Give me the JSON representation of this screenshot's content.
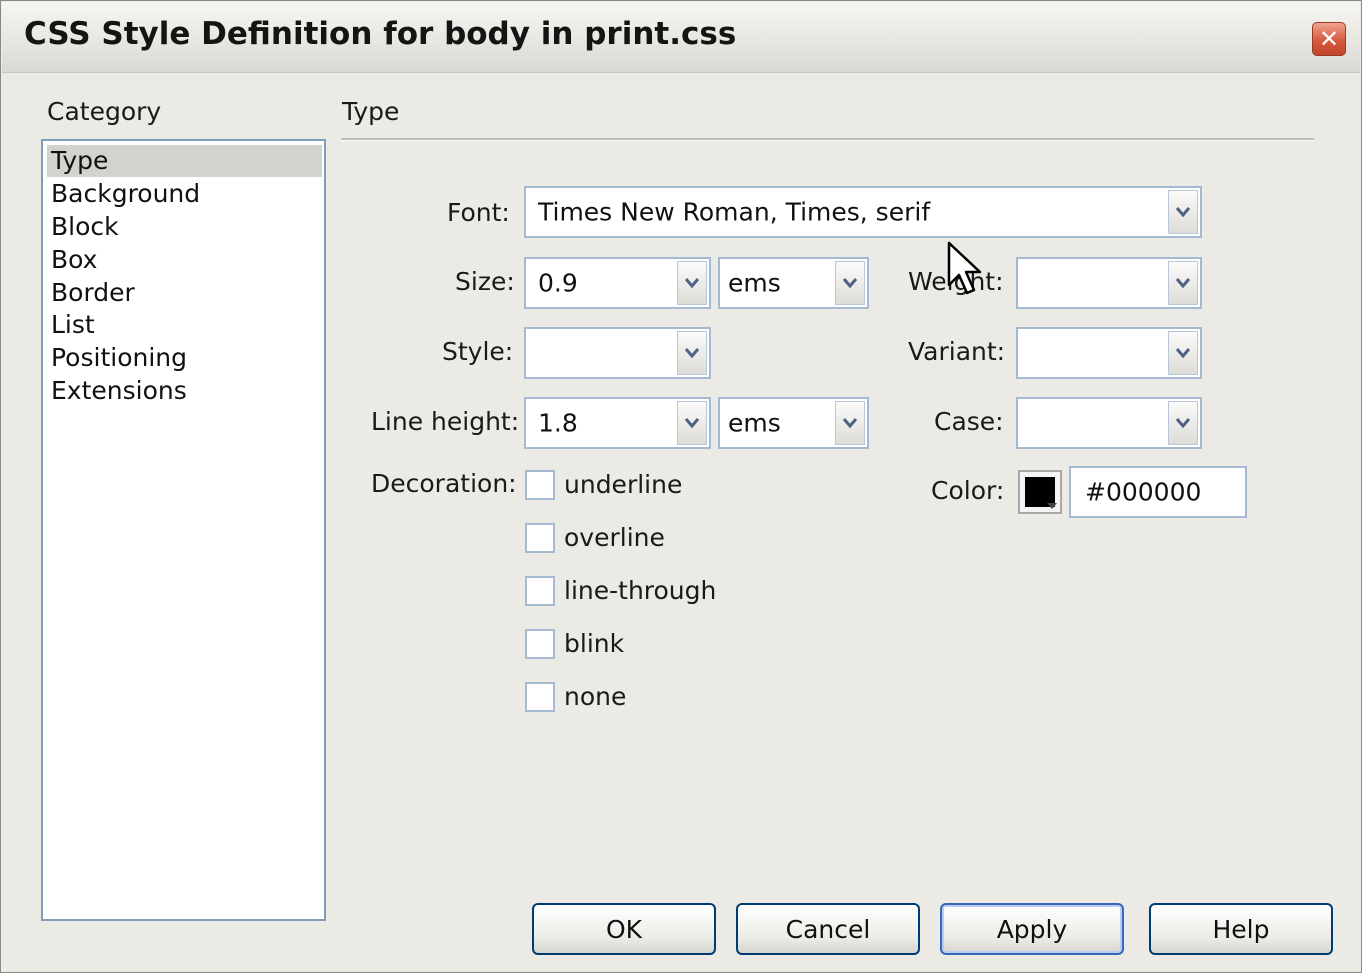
{
  "dialog": {
    "title": "CSS Style Definition for body in print.css",
    "close_glyph": "✕"
  },
  "category": {
    "label": "Category",
    "items": [
      "Type",
      "Background",
      "Block",
      "Box",
      "Border",
      "List",
      "Positioning",
      "Extensions"
    ],
    "selected": "Type"
  },
  "panel": {
    "title": "Type",
    "font": {
      "label": "Font:",
      "value": "Times New Roman, Times, serif"
    },
    "size": {
      "label": "Size:",
      "value": "0.9",
      "unit": "ems"
    },
    "weight": {
      "label": "Weight:",
      "value": ""
    },
    "style": {
      "label": "Style:",
      "value": ""
    },
    "variant": {
      "label": "Variant:",
      "value": ""
    },
    "line_height": {
      "label": "Line height:",
      "value": "1.8",
      "unit": "ems"
    },
    "case": {
      "label": "Case:",
      "value": ""
    },
    "decoration": {
      "label": "Decoration:",
      "options": [
        {
          "label": "underline",
          "checked": false
        },
        {
          "label": "overline",
          "checked": false
        },
        {
          "label": "line-through",
          "checked": false
        },
        {
          "label": "blink",
          "checked": false
        },
        {
          "label": "none",
          "checked": false
        }
      ]
    },
    "color": {
      "label": "Color:",
      "value": "#000000",
      "swatch": "#000000"
    }
  },
  "buttons": {
    "ok": "OK",
    "cancel": "Cancel",
    "apply": "Apply",
    "help": "Help"
  },
  "icons": {
    "dropdown": "chevron-down-icon",
    "close": "close-icon",
    "cursor": "mouse-pointer-icon"
  }
}
